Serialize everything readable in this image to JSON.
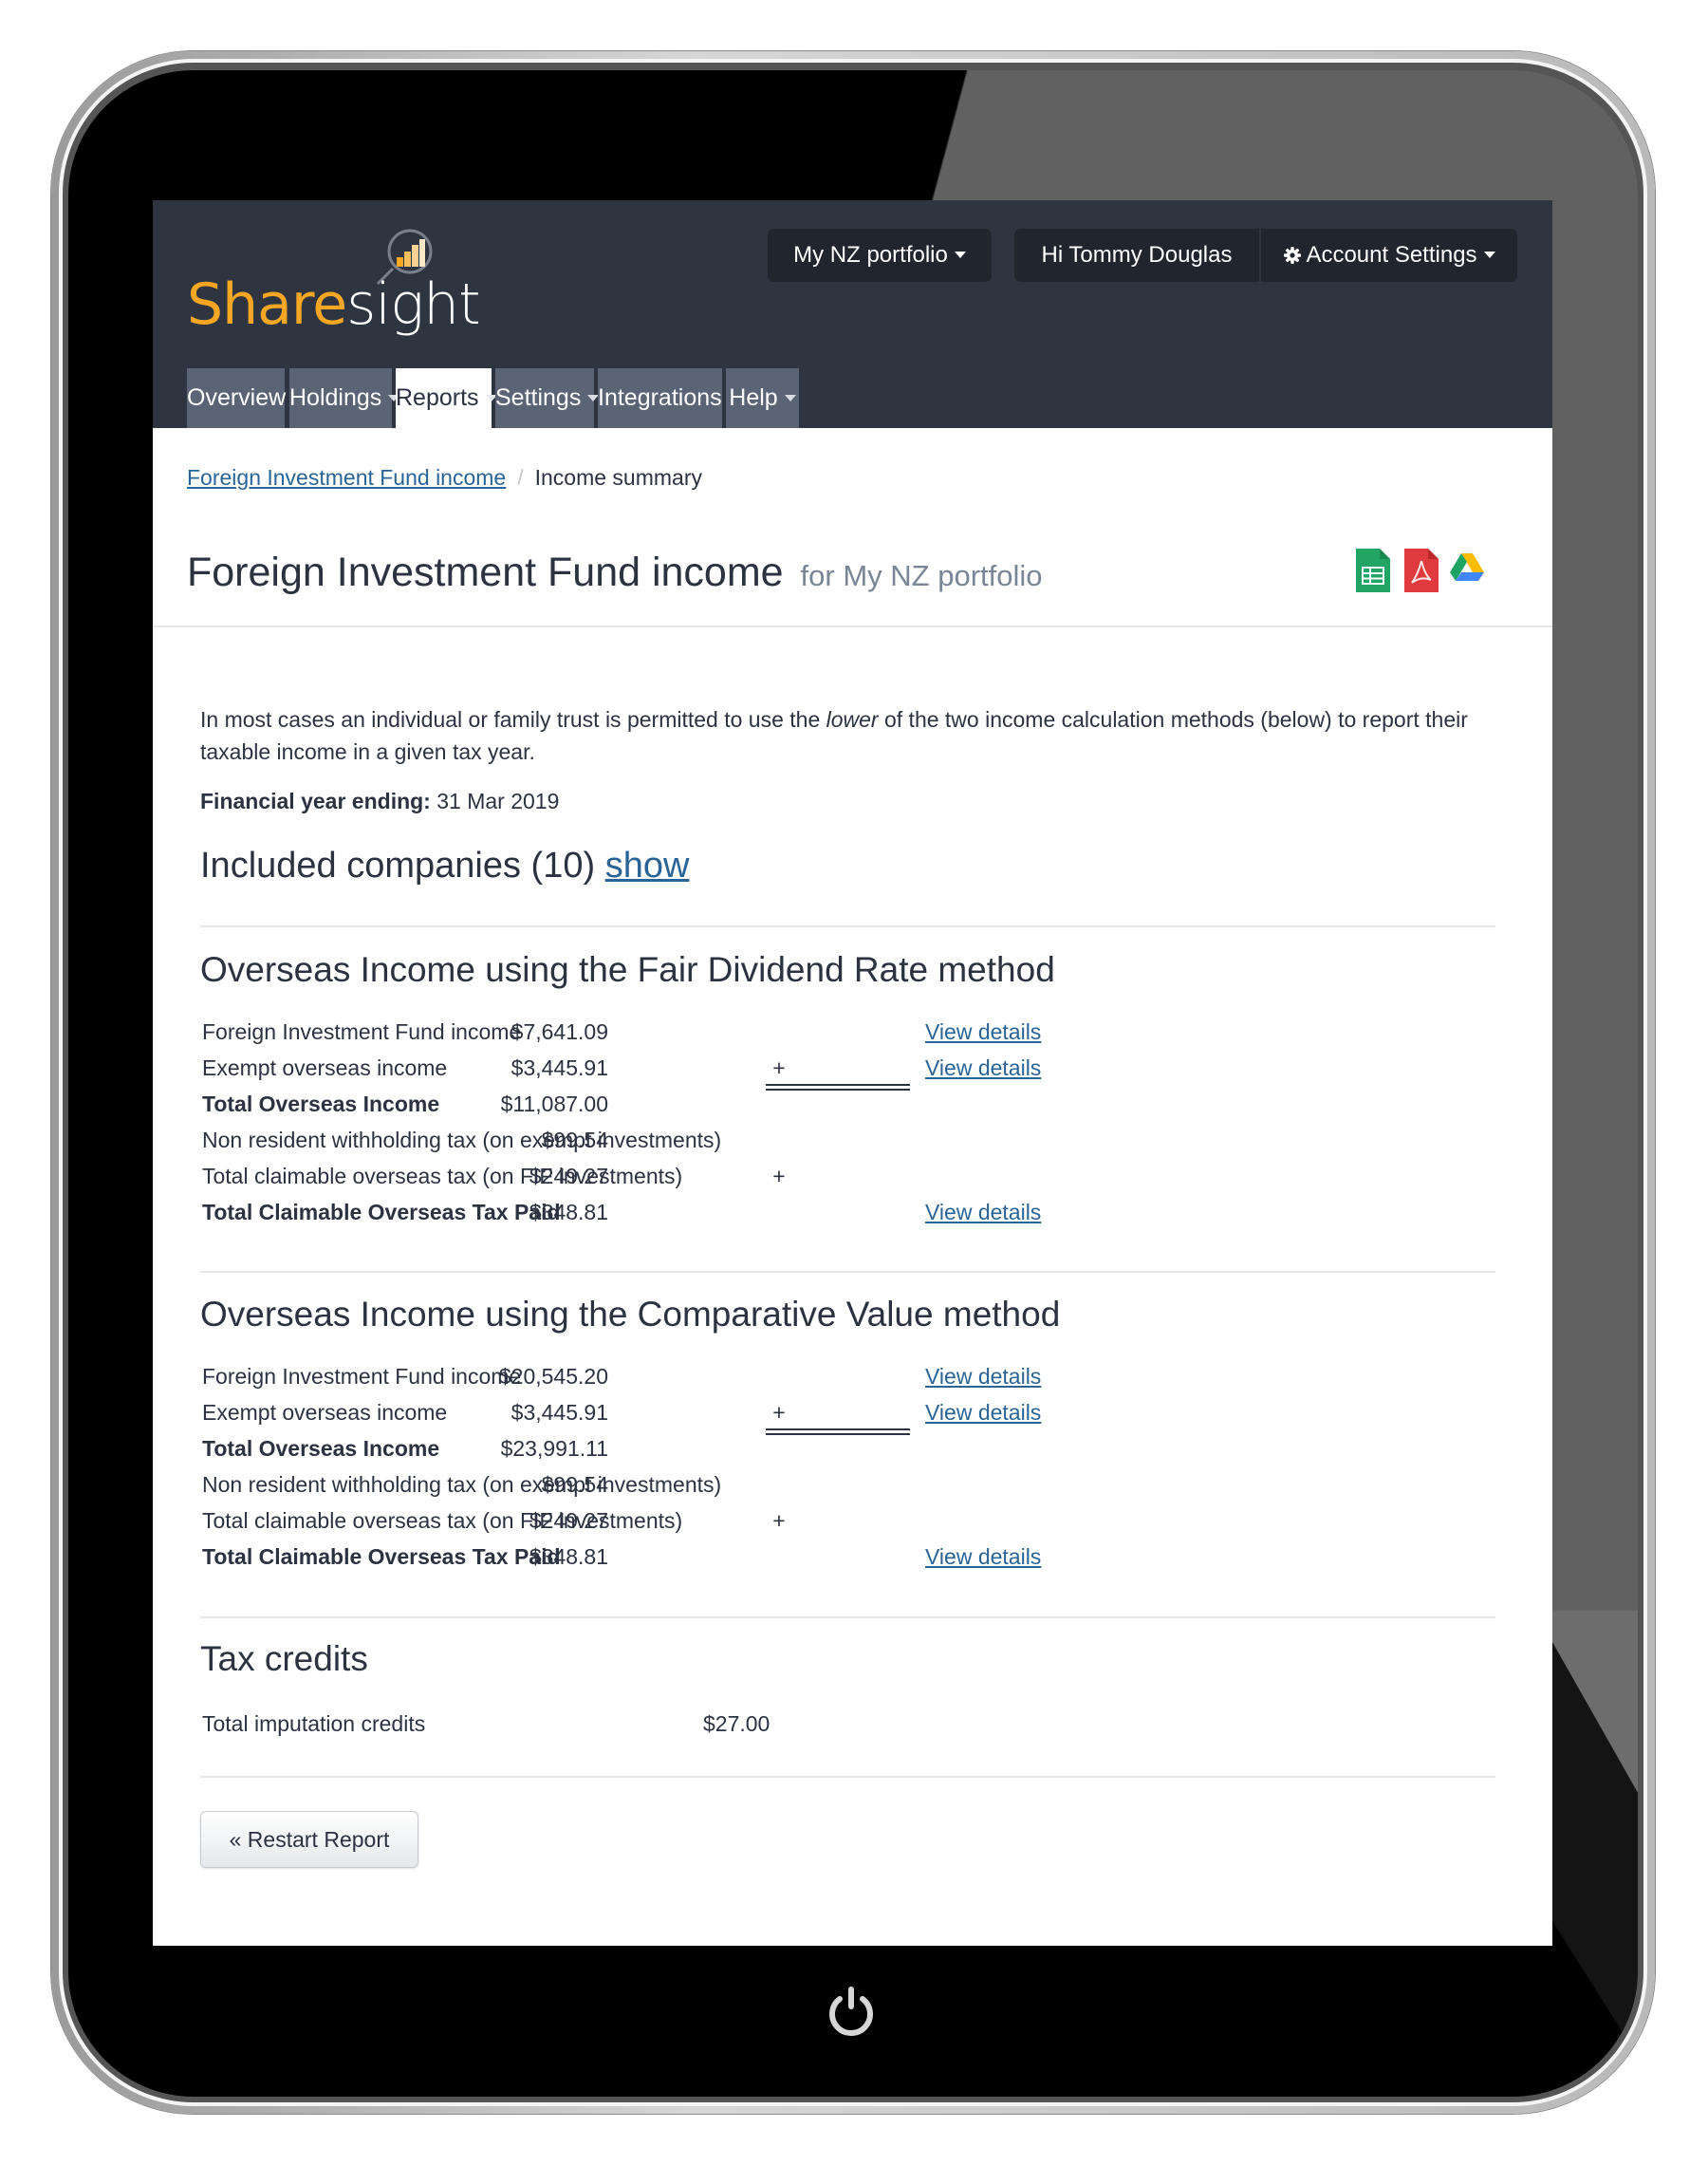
{
  "app": {
    "brand_part1": "Share",
    "brand_part2": "sight",
    "brand_color": "#f5a623"
  },
  "header": {
    "portfolio_selector": "My NZ portfolio",
    "greeting": "Hi Tommy Douglas",
    "account_settings": "Account Settings"
  },
  "nav": {
    "tabs": [
      {
        "label": "Overview",
        "dropdown": false,
        "active": false
      },
      {
        "label": "Holdings",
        "dropdown": true,
        "active": false
      },
      {
        "label": "Reports",
        "dropdown": true,
        "active": true
      },
      {
        "label": "Settings",
        "dropdown": true,
        "active": false
      },
      {
        "label": "Integrations",
        "dropdown": true,
        "active": false
      },
      {
        "label": "Help",
        "dropdown": true,
        "active": false
      }
    ]
  },
  "breadcrumb": {
    "parent": "Foreign Investment Fund income",
    "current": "Income summary"
  },
  "page": {
    "title": "Foreign Investment Fund income",
    "subtitle": "for My NZ portfolio",
    "export_icons": [
      "google-sheets-icon",
      "pdf-icon",
      "google-drive-icon"
    ]
  },
  "intro": {
    "text_before": "In most cases an individual or family trust is permitted to use the ",
    "emphasis": "lower",
    "text_after": " of the two income calculation methods (below) to report their taxable income in a given tax year."
  },
  "financial_year": {
    "label": "Financial year ending:",
    "value": "31 Mar 2019"
  },
  "included_companies": {
    "label": "Included companies (10)",
    "link": "show"
  },
  "sections": [
    {
      "title": "Overseas Income using the Fair Dividend Rate method",
      "rows": [
        {
          "label": "Foreign Investment Fund income",
          "op": "",
          "amount": "$7,641.09",
          "link": "View details",
          "bold": false
        },
        {
          "label": "Exempt overseas income",
          "op": "+",
          "amount": "$3,445.91",
          "link": "View details",
          "bold": false
        },
        {
          "label": "Total Overseas Income",
          "op": "",
          "amount": "$11,087.00",
          "link": "",
          "bold": true
        },
        {
          "label": "Non resident withholding tax (on exempt investments)",
          "op": "",
          "amount": "$99.54",
          "link": "",
          "bold": false
        },
        {
          "label": "Total claimable overseas tax (on FIF investments)",
          "op": "+",
          "amount": "$249.27",
          "link": "",
          "bold": false
        },
        {
          "label": "Total Claimable Overseas Tax Paid",
          "op": "",
          "amount": "$348.81",
          "link": "View details",
          "bold": true
        }
      ]
    },
    {
      "title": "Overseas Income using the Comparative Value method",
      "rows": [
        {
          "label": "Foreign Investment Fund income",
          "op": "",
          "amount": "$20,545.20",
          "link": "View details",
          "bold": false
        },
        {
          "label": "Exempt overseas income",
          "op": "+",
          "amount": "$3,445.91",
          "link": "View details",
          "bold": false
        },
        {
          "label": "Total Overseas Income",
          "op": "",
          "amount": "$23,991.11",
          "link": "",
          "bold": true
        },
        {
          "label": "Non resident withholding tax (on exempt investments)",
          "op": "",
          "amount": "$99.54",
          "link": "",
          "bold": false
        },
        {
          "label": "Total claimable overseas tax (on FIF investments)",
          "op": "+",
          "amount": "$249.27",
          "link": "",
          "bold": false
        },
        {
          "label": "Total Claimable Overseas Tax Paid",
          "op": "",
          "amount": "$348.81",
          "link": "View details",
          "bold": true
        }
      ]
    }
  ],
  "tax_credits": {
    "title": "Tax credits",
    "label": "Total imputation credits",
    "amount": "$27.00"
  },
  "actions": {
    "restart": "« Restart Report"
  },
  "colors": {
    "topbar": "#2e3440",
    "nav_tab": "#5a6474",
    "link": "#2a6496"
  }
}
